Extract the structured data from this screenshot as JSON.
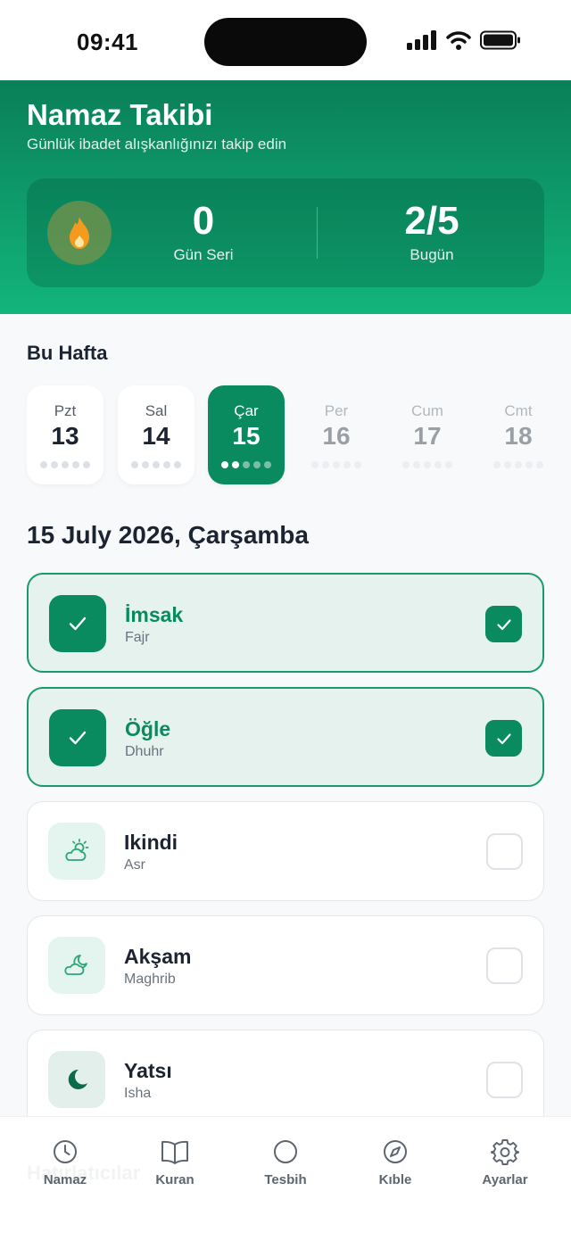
{
  "status_bar": {
    "time": "09:41"
  },
  "header": {
    "title": "Namaz Takibi",
    "subtitle": "Günlük ibadet alışkanlığınızı takip edin",
    "streak": {
      "value": "0",
      "label": "Gün Seri",
      "icon": "flame-icon"
    },
    "today": {
      "value": "2/5",
      "label": "Bugün"
    }
  },
  "week": {
    "title": "Bu Hafta",
    "days": [
      {
        "name": "Pzt",
        "num": "13",
        "completed": 0
      },
      {
        "name": "Sal",
        "num": "14",
        "completed": 0
      },
      {
        "name": "Çar",
        "num": "15",
        "completed": 2,
        "selected": true
      },
      {
        "name": "Per",
        "num": "16",
        "completed": 0
      },
      {
        "name": "Cum",
        "num": "17",
        "completed": 0
      },
      {
        "name": "Cmt",
        "num": "18",
        "completed": 0
      }
    ]
  },
  "date_title": "15 July 2026, Çarşamba",
  "prayers": [
    {
      "name": "İmsak",
      "sub": "Fajr",
      "done": true,
      "icon": "check-icon"
    },
    {
      "name": "Öğle",
      "sub": "Dhuhr",
      "done": true,
      "icon": "check-icon"
    },
    {
      "name": "Ikindi",
      "sub": "Asr",
      "done": false,
      "icon": "sun-cloud-icon"
    },
    {
      "name": "Akşam",
      "sub": "Maghrib",
      "done": false,
      "icon": "moon-cloud-icon"
    },
    {
      "name": "Yatsı",
      "sub": "Isha",
      "done": false,
      "icon": "crescent-moon-icon"
    }
  ],
  "ghost_section": "Hatırlatıcılar",
  "tabs": [
    {
      "label": "Namaz",
      "icon": "clock-icon"
    },
    {
      "label": "Kuran",
      "icon": "book-icon"
    },
    {
      "label": "Tesbih",
      "icon": "circle-icon"
    },
    {
      "label": "Kıble",
      "icon": "compass-icon"
    },
    {
      "label": "Ayarlar",
      "icon": "gear-icon"
    }
  ],
  "colors": {
    "primary": "#0a8a5f",
    "header_top": "#0a7f58",
    "header_bottom": "#12b57c",
    "flame": "#f59a1c"
  }
}
